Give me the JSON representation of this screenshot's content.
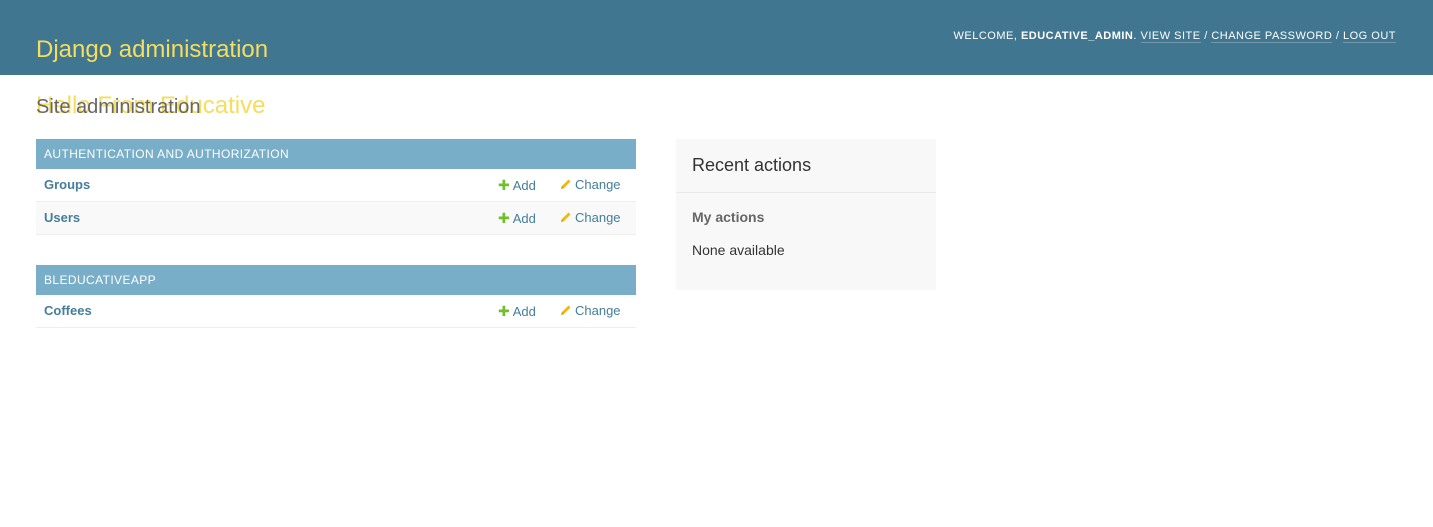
{
  "header": {
    "branding_line1": "Django administration",
    "branding_line2": "Hello From Educative",
    "welcome": "WELCOME,",
    "username": "EDUCATIVE_ADMIN",
    "username_suffix": ".",
    "view_site": "VIEW SITE",
    "separator": "/",
    "change_password": "CHANGE PASSWORD",
    "log_out": "LOG OUT"
  },
  "page": {
    "title": "Site administration"
  },
  "modules": [
    {
      "caption": "AUTHENTICATION AND AUTHORIZATION",
      "rows": [
        {
          "name": "Groups",
          "add": "Add",
          "change": "Change"
        },
        {
          "name": "Users",
          "add": "Add",
          "change": "Change"
        }
      ]
    },
    {
      "caption": "BLEDUCATIVEAPP",
      "rows": [
        {
          "name": "Coffees",
          "add": "Add",
          "change": "Change"
        }
      ]
    }
  ],
  "recent_actions": {
    "title": "Recent actions",
    "my_actions": "My actions",
    "empty": "None available"
  },
  "icons": {
    "add": "plus-icon",
    "change": "pencil-icon"
  },
  "colors": {
    "header_bg": "#417690",
    "branding": "#f5dd5d",
    "module_caption_bg": "#79aec8",
    "link": "#447e9b",
    "add_icon": "#70bf2b",
    "change_icon": "#efb80b"
  }
}
